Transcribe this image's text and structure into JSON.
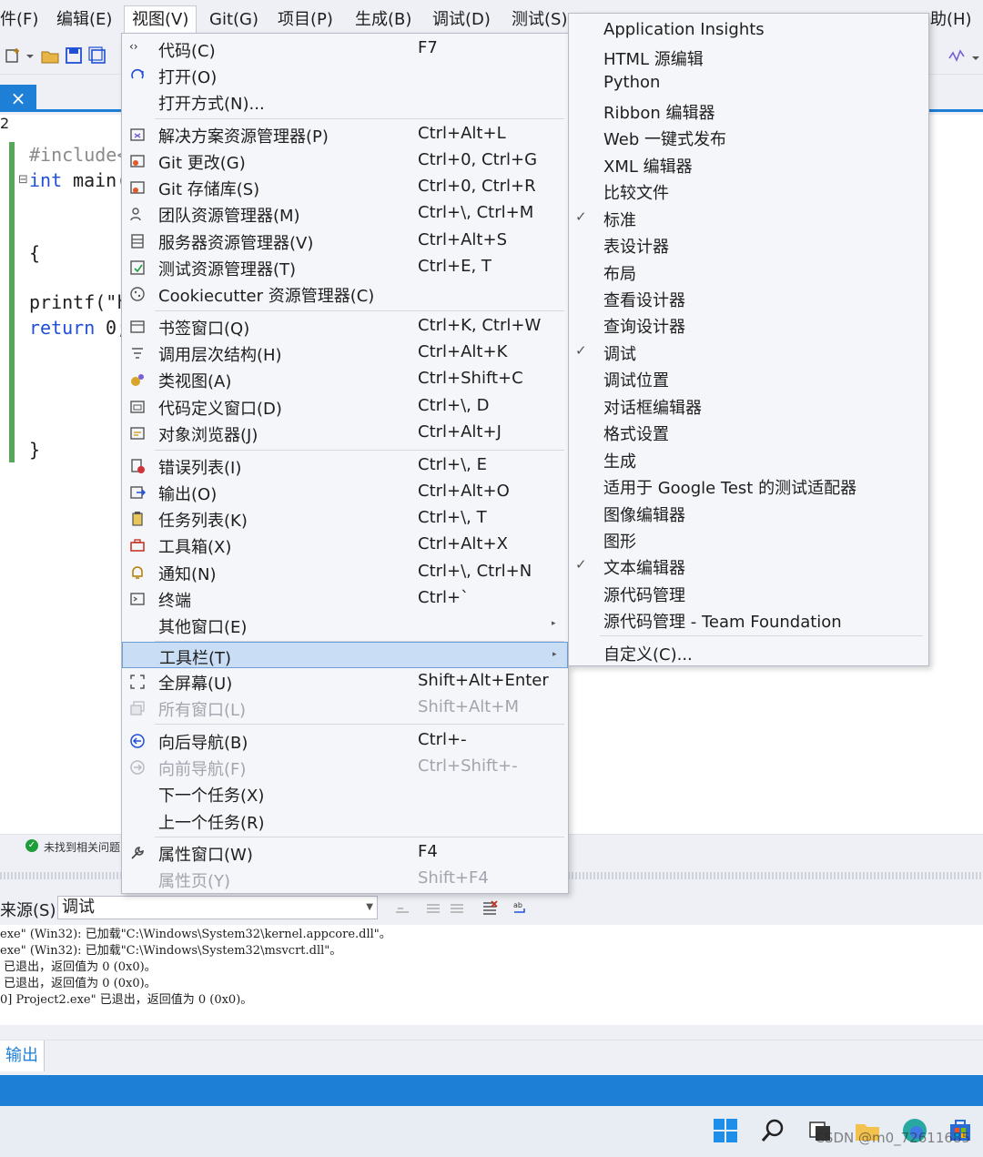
{
  "menubar": {
    "items": [
      "件(F)",
      "编辑(E)",
      "视图(V)",
      "Git(G)",
      "项目(P)",
      "生成(B)",
      "调试(D)",
      "测试(S)"
    ],
    "help_fragment": "助(H)"
  },
  "editor": {
    "tab_close": "×",
    "tab_number": "2",
    "lines": {
      "include": "#include<",
      "int_kw": "int",
      "main": " main(",
      "open_brace": "{",
      "printf": "printf(\"h",
      "return_kw": "return",
      "return_val": " 0;",
      "close_brace": "}"
    }
  },
  "status": {
    "ok_glyph": "✓",
    "text": "未找到相关问题"
  },
  "output": {
    "source_label": "来源(S):",
    "source_value": "调试",
    "lines": [
      "exe\" (Win32): 已加载\"C:\\Windows\\System32\\kernel.appcore.dll\"。",
      "exe\" (Win32): 已加载\"C:\\Windows\\System32\\msvcrt.dll\"。",
      " 已退出，返回值为 0 (0x0)。",
      " 已退出，返回值为 0 (0x0)。",
      "0] Project2.exe\" 已退出，返回值为 0 (0x0)。"
    ],
    "tab_label": "输出"
  },
  "taskbar": {
    "watermark": "CSDN @m0_72611685"
  },
  "view_menu": {
    "items": [
      {
        "label": "代码(C)",
        "shortcut": "F7",
        "icon": "code-icon"
      },
      {
        "label": "打开(O)",
        "shortcut": "",
        "icon": "open-icon"
      },
      {
        "label": "打开方式(N)...",
        "shortcut": "",
        "icon": ""
      },
      {
        "label": "解决方案资源管理器(P)",
        "shortcut": "Ctrl+Alt+L",
        "icon": "solution-explorer-icon"
      },
      {
        "label": "Git 更改(G)",
        "shortcut": "Ctrl+0, Ctrl+G",
        "icon": "git-changes-icon"
      },
      {
        "label": "Git 存储库(S)",
        "shortcut": "Ctrl+0, Ctrl+R",
        "icon": "git-repo-icon"
      },
      {
        "label": "团队资源管理器(M)",
        "shortcut": "Ctrl+\\, Ctrl+M",
        "icon": "team-explorer-icon"
      },
      {
        "label": "服务器资源管理器(V)",
        "shortcut": "Ctrl+Alt+S",
        "icon": "server-explorer-icon"
      },
      {
        "label": "测试资源管理器(T)",
        "shortcut": "Ctrl+E, T",
        "icon": "test-explorer-icon"
      },
      {
        "label": "Cookiecutter 资源管理器(C)",
        "shortcut": "",
        "icon": "cookiecutter-icon"
      },
      {
        "label": "书签窗口(Q)",
        "shortcut": "Ctrl+K, Ctrl+W",
        "icon": "bookmark-icon"
      },
      {
        "label": "调用层次结构(H)",
        "shortcut": "Ctrl+Alt+K",
        "icon": "call-hierarchy-icon"
      },
      {
        "label": "类视图(A)",
        "shortcut": "Ctrl+Shift+C",
        "icon": "class-view-icon"
      },
      {
        "label": "代码定义窗口(D)",
        "shortcut": "Ctrl+\\, D",
        "icon": "code-definition-icon"
      },
      {
        "label": "对象浏览器(J)",
        "shortcut": "Ctrl+Alt+J",
        "icon": "object-browser-icon"
      },
      {
        "label": "错误列表(I)",
        "shortcut": "Ctrl+\\, E",
        "icon": "error-list-icon"
      },
      {
        "label": "输出(O)",
        "shortcut": "Ctrl+Alt+O",
        "icon": "output-icon"
      },
      {
        "label": "任务列表(K)",
        "shortcut": "Ctrl+\\, T",
        "icon": "task-list-icon"
      },
      {
        "label": "工具箱(X)",
        "shortcut": "Ctrl+Alt+X",
        "icon": "toolbox-icon"
      },
      {
        "label": "通知(N)",
        "shortcut": "Ctrl+\\, Ctrl+N",
        "icon": "bell-icon"
      },
      {
        "label": "终端",
        "shortcut": "Ctrl+`",
        "icon": "terminal-icon"
      },
      {
        "label": "其他窗口(E)",
        "shortcut": "",
        "icon": ""
      },
      {
        "label": "工具栏(T)",
        "shortcut": "",
        "icon": ""
      },
      {
        "label": "全屏幕(U)",
        "shortcut": "Shift+Alt+Enter",
        "icon": "fullscreen-icon"
      },
      {
        "label": "所有窗口(L)",
        "shortcut": "Shift+Alt+M",
        "icon": "all-windows-icon"
      },
      {
        "label": "向后导航(B)",
        "shortcut": "Ctrl+-",
        "icon": "navigate-back-icon"
      },
      {
        "label": "向前导航(F)",
        "shortcut": "Ctrl+Shift+-",
        "icon": "navigate-forward-icon"
      },
      {
        "label": "下一个任务(X)",
        "shortcut": "",
        "icon": ""
      },
      {
        "label": "上一个任务(R)",
        "shortcut": "",
        "icon": ""
      },
      {
        "label": "属性窗口(W)",
        "shortcut": "F4",
        "icon": "wrench-icon"
      },
      {
        "label": "属性页(Y)",
        "shortcut": "Shift+F4",
        "icon": ""
      }
    ]
  },
  "toolbars_menu": {
    "items": [
      {
        "label": "Application Insights",
        "checked": false
      },
      {
        "label": "HTML 源编辑",
        "checked": false
      },
      {
        "label": "Python",
        "checked": false
      },
      {
        "label": "Ribbon 编辑器",
        "checked": false
      },
      {
        "label": "Web 一键式发布",
        "checked": false
      },
      {
        "label": "XML 编辑器",
        "checked": false
      },
      {
        "label": "比较文件",
        "checked": false
      },
      {
        "label": "标准",
        "checked": true
      },
      {
        "label": "表设计器",
        "checked": false
      },
      {
        "label": "布局",
        "checked": false
      },
      {
        "label": "查看设计器",
        "checked": false
      },
      {
        "label": "查询设计器",
        "checked": false
      },
      {
        "label": "调试",
        "checked": true
      },
      {
        "label": "调试位置",
        "checked": false
      },
      {
        "label": "对话框编辑器",
        "checked": false
      },
      {
        "label": "格式设置",
        "checked": false
      },
      {
        "label": "生成",
        "checked": false
      },
      {
        "label": "适用于 Google Test 的测试适配器",
        "checked": false
      },
      {
        "label": "图像编辑器",
        "checked": false
      },
      {
        "label": "图形",
        "checked": false
      },
      {
        "label": "文本编辑器",
        "checked": true
      },
      {
        "label": "源代码管理",
        "checked": false
      },
      {
        "label": "源代码管理 - Team Foundation",
        "checked": false
      },
      {
        "label": "自定义(C)...",
        "checked": false
      }
    ],
    "check_glyph": "✓"
  },
  "colors": {
    "accent": "#1e7fd6",
    "highlight": "#c9ddf5",
    "keyword": "#1f4fd6",
    "ok_green": "#1f9d3a"
  }
}
